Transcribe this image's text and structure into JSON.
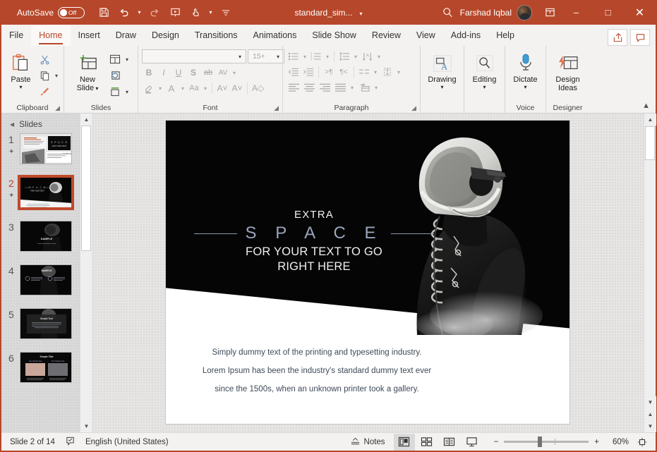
{
  "titlebar": {
    "autosave_label": "AutoSave",
    "autosave_state": "Off",
    "document_title": "standard_sim...",
    "user_name": "Farshad Iqbal",
    "qat": [
      {
        "name": "save-icon",
        "glyph": "save"
      },
      {
        "name": "undo-icon",
        "glyph": "undo"
      },
      {
        "name": "redo-icon",
        "glyph": "redo"
      },
      {
        "name": "start-from-beginning-icon",
        "glyph": "present"
      },
      {
        "name": "touch-mode-icon",
        "glyph": "touch"
      },
      {
        "name": "customize-qat-icon",
        "glyph": "more"
      }
    ],
    "window_buttons": {
      "minimize": "–",
      "maximize": "□",
      "close": "✕"
    },
    "accent_color": "#B7472A"
  },
  "tabs": [
    {
      "label": "File",
      "active": false
    },
    {
      "label": "Home",
      "active": true
    },
    {
      "label": "Insert",
      "active": false
    },
    {
      "label": "Draw",
      "active": false
    },
    {
      "label": "Design",
      "active": false
    },
    {
      "label": "Transitions",
      "active": false
    },
    {
      "label": "Animations",
      "active": false
    },
    {
      "label": "Slide Show",
      "active": false
    },
    {
      "label": "Review",
      "active": false
    },
    {
      "label": "View",
      "active": false
    },
    {
      "label": "Add-ins",
      "active": false
    },
    {
      "label": "Help",
      "active": false
    }
  ],
  "tabs_right": [
    {
      "name": "share-button",
      "glyph": "share"
    },
    {
      "name": "comments-button",
      "glyph": "comment"
    }
  ],
  "ribbon": {
    "clipboard": {
      "group_label": "Clipboard",
      "paste_label": "Paste",
      "items": [
        "cut-icon",
        "copy-icon",
        "format-painter-icon"
      ]
    },
    "slides": {
      "group_label": "Slides",
      "new_slide_label": "New\nSlide",
      "new_slide_line1": "New",
      "new_slide_line2": "Slide",
      "items": [
        "layout-icon",
        "reset-icon",
        "section-icon"
      ]
    },
    "font": {
      "group_label": "Font",
      "font_name_value": "",
      "font_size_value": "15+",
      "buttons": [
        "B",
        "I",
        "U",
        "S",
        "ab",
        "AV"
      ],
      "row2": [
        "text-highlight-icon",
        "font-color-icon",
        "change-case-icon",
        "increase-font-icon",
        "decrease-font-icon",
        "clear-formatting-icon"
      ]
    },
    "paragraph": {
      "group_label": "Paragraph"
    },
    "drawing": {
      "group_label": "",
      "label": "Drawing"
    },
    "editing": {
      "group_label": "",
      "label": "Editing"
    },
    "voice": {
      "group_label": "Voice",
      "label": "Dictate"
    },
    "designer": {
      "group_label": "Designer",
      "label_line1": "Design",
      "label_line2": "Ideas"
    }
  },
  "thumbnails": {
    "header_label": "Slides",
    "slides": [
      {
        "number": "1",
        "selected": false,
        "has_star": true
      },
      {
        "number": "2",
        "selected": true,
        "has_star": true
      },
      {
        "number": "3",
        "selected": false,
        "has_star": false
      },
      {
        "number": "4",
        "selected": false,
        "has_star": false
      },
      {
        "number": "5",
        "selected": false,
        "has_star": false
      },
      {
        "number": "6",
        "selected": false,
        "has_star": false
      }
    ]
  },
  "slide": {
    "title_small": "EXTRA",
    "title_big": "S P A C E",
    "subtitle_line1": "FOR YOUR TEXT TO GO",
    "subtitle_line2": "RIGHT HERE",
    "body_line1": "Simply dummy text of the printing and typesetting industry.",
    "body_line2": "Lorem Ipsum has been the industry's standard dummy text ever",
    "body_line3": "since the 1500s, when an unknown printer took a gallery.",
    "accent_text_color": "#9aa4bb",
    "background_color": "#050505"
  },
  "status": {
    "slide_counter": "Slide 2 of 14",
    "language": "English (United States)",
    "notes_label": "Notes",
    "views": [
      {
        "name": "normal-view-button",
        "active": true
      },
      {
        "name": "slide-sorter-view-button",
        "active": false
      },
      {
        "name": "reading-view-button",
        "active": false
      },
      {
        "name": "slide-show-button",
        "active": false
      }
    ],
    "zoom_out_label": "−",
    "zoom_in_label": "+",
    "zoom_level": "60%"
  }
}
